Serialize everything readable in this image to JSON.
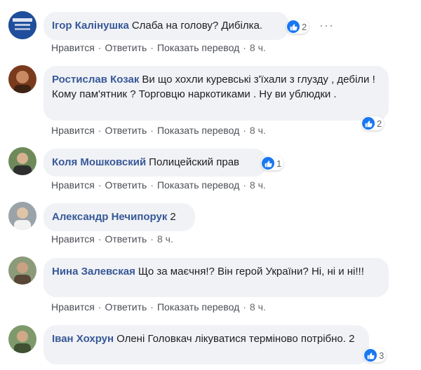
{
  "actions": {
    "like": "Нравится",
    "reply": "Ответить",
    "translate": "Показать перевод"
  },
  "comments": [
    {
      "author": "Ігор Калінушка",
      "text": "Слаба на голову? Дибілка.",
      "reactions": "2",
      "time": "8 ч.",
      "has_translate": true
    },
    {
      "author": "Ростислав Козак",
      "text": "Ви що хохли куревські з'їхали з глузду , дебіли ! Кому пам'ятник ? Торговцю наркотиками . Ну ви ублюдки .",
      "reactions": "2",
      "time": "8 ч.",
      "has_translate": true
    },
    {
      "author": "Коля Мошковский",
      "text": "Полицейский прав",
      "reactions": "1",
      "time": "8 ч.",
      "has_translate": true
    },
    {
      "author": "Александр Нечипорук",
      "text": "2",
      "reactions": "",
      "time": "8 ч.",
      "has_translate": false
    },
    {
      "author": "Нина Залевская",
      "text": "Що за маєчня!? Він герой України? Ні, ні и ні!!!",
      "reactions": "",
      "time": "8 ч.",
      "has_translate": true
    },
    {
      "author": "Іван Хохрун",
      "text": "Олені Головкач лікуватися терміново потрібно. 2",
      "reactions": "3",
      "time": "",
      "has_translate": false
    }
  ],
  "more_label": "···",
  "icons": {
    "like": "thumbs-up-icon",
    "more": "more-options-icon"
  },
  "colors": {
    "author": "#385898",
    "like": "#1877f2",
    "bubble": "#f0f2f5"
  }
}
